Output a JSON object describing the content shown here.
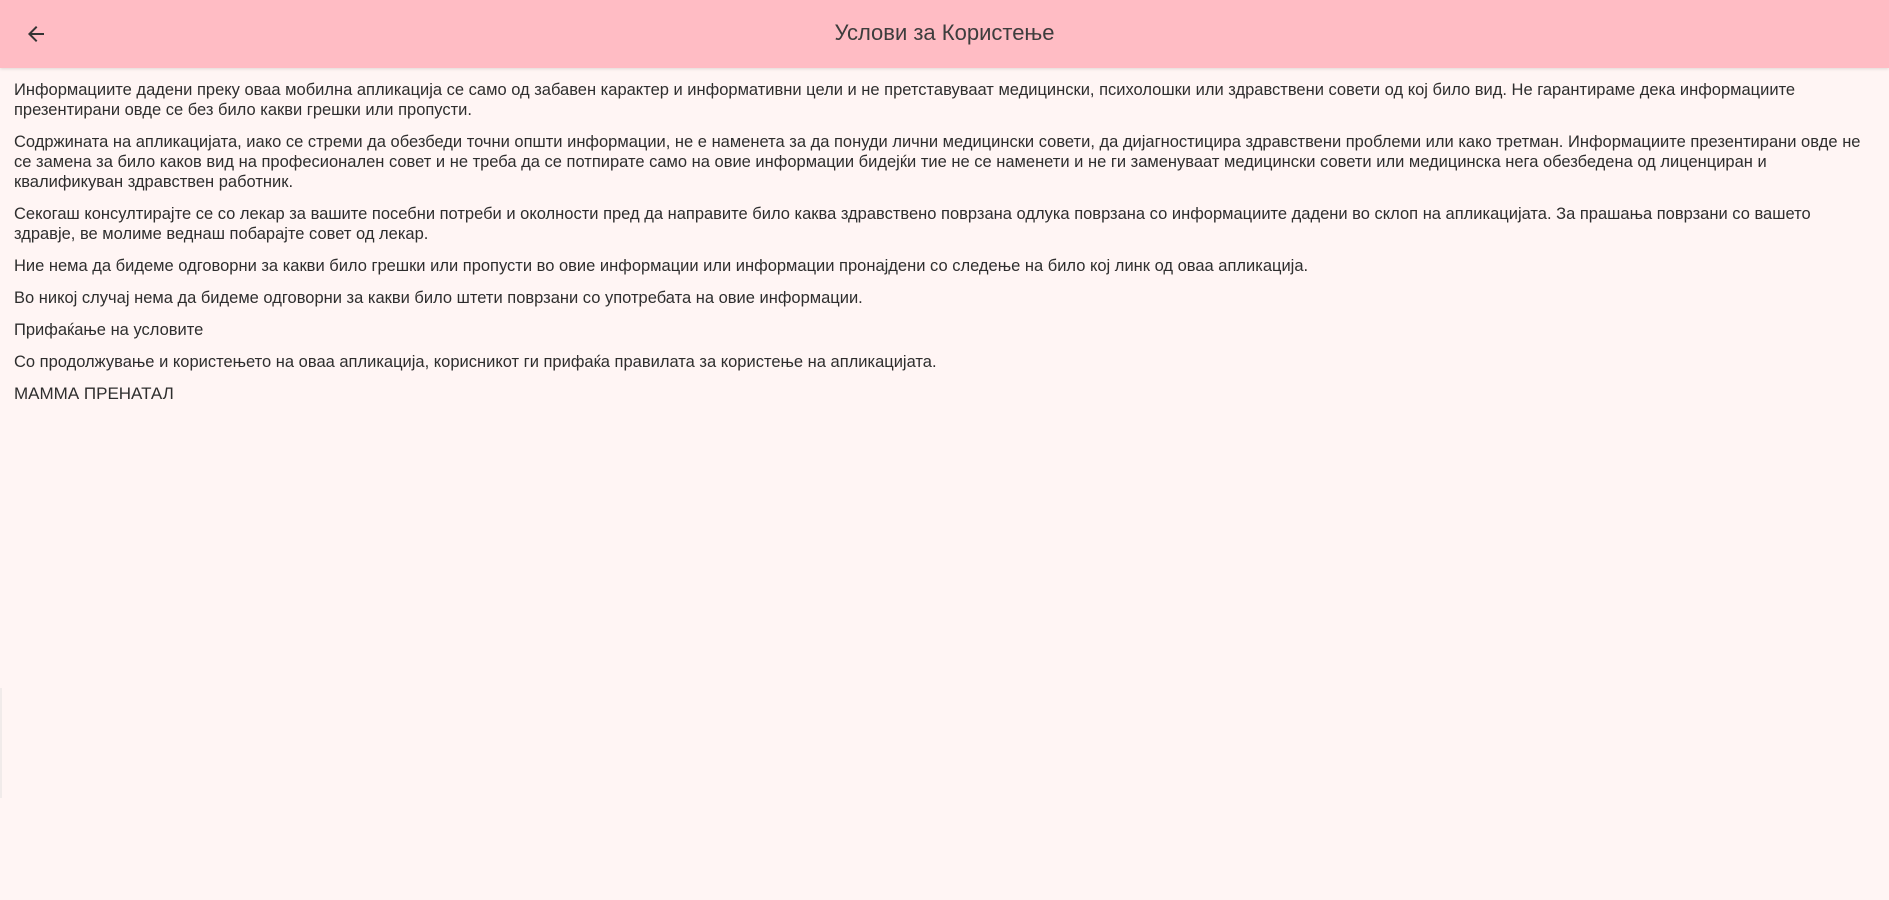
{
  "header": {
    "title": "Услови за Користење",
    "back_icon": "arrow-left-icon"
  },
  "terms": {
    "paragraphs": [
      "Информациите дадени преку оваа мобилна апликација се само од забавен карактер и информативни цели и не претставуваат медицински, психолошки или здравствени совети од кој било вид. Не гарантираме дека информациите презентирани овде се без било какви грешки или пропусти.",
      "Содржината на апликацијата, иако се стреми да обезбеди точни општи информации, не е наменета за да понуди лични медицински совети, да дијагностицира здравствени проблеми или како третман. Информациите презентирани овде не се замена за било каков вид на професионален совет и не треба да се потпирате само на овие информации бидејќи тие не се наменети и не ги заменуваат медицински совети или медицинска нега обезбедена од лиценциран и квалификуван здравствен работник.",
      "Секогаш консултирајте се со лекар за вашите посебни потреби и околности пред да направите било каква здравствено поврзана одлука поврзана со информациите дадени во склоп на апликацијата. За прашања поврзани со вашето здравје, ве молиме веднаш побарајте совет од лекар.",
      "Ние нема да бидеме одговорни за какви било грешки или пропусти во овие информации или информации пронајдени со следење на било кој линк од оваа апликација.",
      "Во никој случај нема да бидеме одговорни за какви било штети поврзани со употребата на овие информации.",
      "Прифаќање на условите",
      "Со продолжување и користењето на оваа апликација, корисникот ги прифаќа правилата за користење на апликацијата.",
      "МАММА ПРЕНАТАЛ"
    ]
  },
  "colors": {
    "app_bar": "#ffbcc4",
    "background": "#fff5f4",
    "text": "#2e2e2e"
  }
}
